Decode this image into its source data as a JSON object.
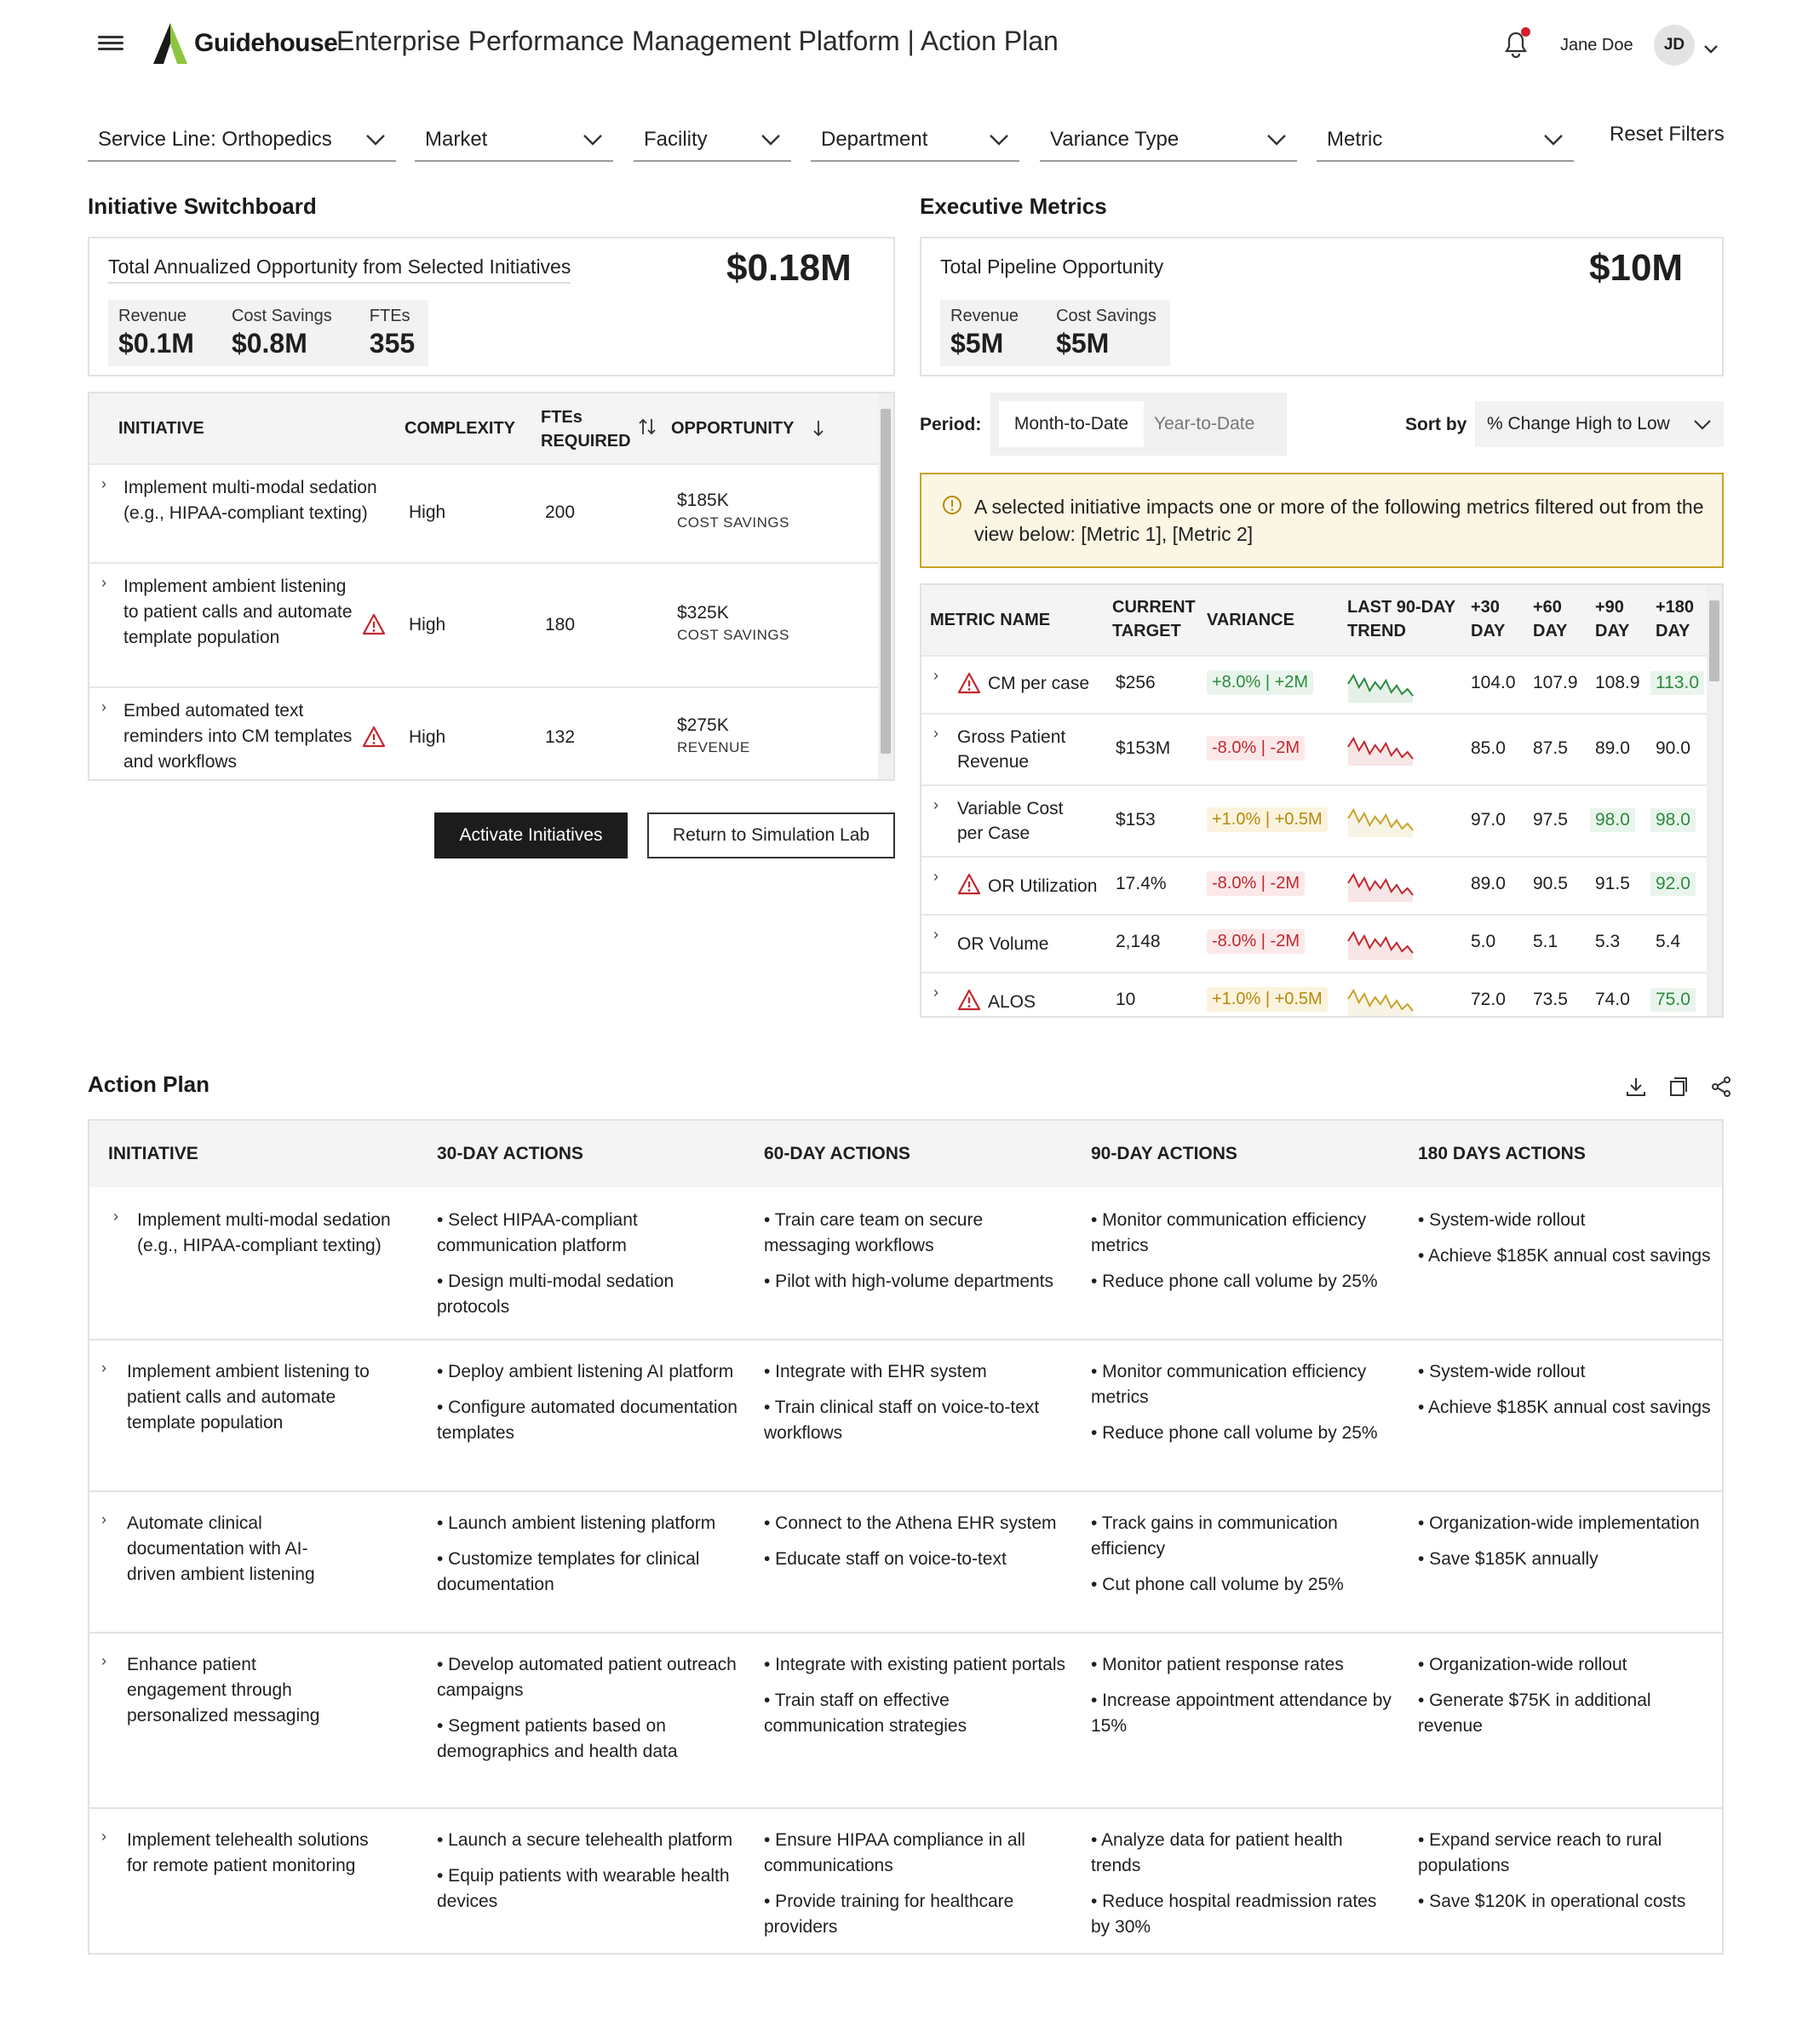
{
  "header": {
    "brand": "Guidehouse",
    "title": "Enterprise Performance Management Platform | Action Plan",
    "user_name": "Jane Doe",
    "user_initials": "JD"
  },
  "filters": [
    {
      "label": "Service Line: Orthopedics"
    },
    {
      "label": "Market"
    },
    {
      "label": "Facility"
    },
    {
      "label": "Department"
    },
    {
      "label": "Variance Type"
    },
    {
      "label": "Metric"
    }
  ],
  "reset_filters": "Reset Filters",
  "switchboard": {
    "title": "Initiative Switchboard",
    "summary_label": "Total Annualized Opportunity from Selected Initiatives",
    "summary_value": "$0.18M",
    "chips": [
      {
        "label": "Revenue",
        "value": "$0.1M"
      },
      {
        "label": "Cost Savings",
        "value": "$0.8M"
      },
      {
        "label": "FTEs",
        "value": "355"
      }
    ],
    "columns": {
      "initiative": "INITIATIVE",
      "complexity": "COMPLEXITY",
      "ftes": "FTEs REQUIRED",
      "opportunity": "OPPORTUNITY"
    },
    "rows": [
      {
        "name": "Implement multi-modal sedation (e.g., HIPAA-compliant texting)",
        "complexity": "High",
        "ftes": "200",
        "opp_value": "$185K",
        "opp_type": "COST SAVINGS",
        "warning": false
      },
      {
        "name": "Implement ambient listening to patient calls and automate template population",
        "complexity": "High",
        "ftes": "180",
        "opp_value": "$325K",
        "opp_type": "COST SAVINGS",
        "warning": true
      },
      {
        "name": "Embed automated text reminders into CM templates and workflows",
        "complexity": "High",
        "ftes": "132",
        "opp_value": "$275K",
        "opp_type": "REVENUE",
        "warning": true
      }
    ],
    "activate_label": "Activate Initiatives",
    "return_label": "Return to Simulation Lab"
  },
  "executive": {
    "title": "Executive Metrics",
    "summary_label": "Total Pipeline Opportunity",
    "summary_value": "$10M",
    "chips": [
      {
        "label": "Revenue",
        "value": "$5M"
      },
      {
        "label": "Cost Savings",
        "value": "$5M"
      }
    ],
    "period_label": "Period:",
    "period_options": [
      "Month-to-Date",
      "Year-to-Date"
    ],
    "sort_label": "Sort by",
    "sort_value": "% Change High to Low",
    "alert": "A selected initiative impacts one or more of the following metrics filtered out from the view below: [Metric 1], [Metric 2]",
    "columns": {
      "name": "METRIC NAME",
      "target": "CURRENT TARGET",
      "variance": "VARIANCE",
      "trend": "LAST 90-DAY TREND",
      "d30": "+30 DAY",
      "d60": "+60 DAY",
      "d90": "+90 DAY",
      "d180": "+180 DAY"
    },
    "rows": [
      {
        "name": "CM per case",
        "warning": true,
        "target": "$256",
        "variance": "+8.0% | +2M",
        "tone": "pos",
        "d30": "104.0",
        "d60": "107.9",
        "d90": "108.9",
        "d180": "113.0",
        "hl": [
          false,
          false,
          false,
          true
        ]
      },
      {
        "name": "Gross Patient Revenue",
        "warning": false,
        "target": "$153M",
        "variance": "-8.0% | -2M",
        "tone": "neg",
        "d30": "85.0",
        "d60": "87.5",
        "d90": "89.0",
        "d180": "90.0",
        "hl": [
          false,
          false,
          false,
          false
        ]
      },
      {
        "name": "Variable Cost per Case",
        "warning": false,
        "target": "$153",
        "variance": "+1.0% | +0.5M",
        "tone": "mix",
        "d30": "97.0",
        "d60": "97.5",
        "d90": "98.0",
        "d180": "98.0",
        "hl": [
          false,
          false,
          true,
          true
        ]
      },
      {
        "name": "OR Utilization",
        "warning": true,
        "target": "17.4%",
        "variance": "-8.0% | -2M",
        "tone": "neg",
        "d30": "89.0",
        "d60": "90.5",
        "d90": "91.5",
        "d180": "92.0",
        "hl": [
          false,
          false,
          false,
          true
        ]
      },
      {
        "name": "OR Volume",
        "warning": false,
        "target": "2,148",
        "variance": "-8.0% | -2M",
        "tone": "neg",
        "d30": "5.0",
        "d60": "5.1",
        "d90": "5.3",
        "d180": "5.4",
        "hl": [
          false,
          false,
          false,
          false
        ]
      },
      {
        "name": "ALOS",
        "warning": true,
        "target": "10",
        "variance": "+1.0% | +0.5M",
        "tone": "mix",
        "d30": "72.0",
        "d60": "73.5",
        "d90": "74.0",
        "d180": "75.0",
        "hl": [
          false,
          false,
          false,
          true
        ]
      }
    ],
    "colors": {
      "pos": "#2c8a3f",
      "neg": "#c2272d",
      "mix": "#c9a227"
    }
  },
  "action_plan": {
    "title": "Action Plan",
    "columns": [
      "INITIATIVE",
      "30-DAY ACTIONS",
      "60-DAY ACTIONS",
      "90-DAY ACTIONS",
      "180 DAYS ACTIONS"
    ],
    "rows": [
      {
        "name": "Implement multi-modal sedation (e.g., HIPAA-compliant texting)",
        "a30": [
          "• Select HIPAA-compliant communication platform",
          "• Design multi-modal sedation protocols"
        ],
        "a60": [
          "• Train care team on secure messaging workflows",
          "• Pilot with high-volume departments"
        ],
        "a90": [
          "• Monitor communication efficiency metrics",
          "• Reduce phone call volume by 25%"
        ],
        "a180": [
          "• System-wide rollout",
          "• Achieve $185K annual cost savings"
        ]
      },
      {
        "name": "Implement ambient listening to patient calls and automate template population",
        "a30": [
          "• Deploy ambient listening AI platform",
          "• Configure automated documentation templates"
        ],
        "a60": [
          "• Integrate with EHR system",
          "• Train clinical staff on voice-to-text workflows"
        ],
        "a90": [
          "• Monitor communication efficiency metrics",
          "• Reduce phone call volume by 25%"
        ],
        "a180": [
          "• System-wide rollout",
          "• Achieve $185K annual cost savings"
        ]
      },
      {
        "name": "Automate clinical documentation with AI-driven ambient listening",
        "a30": [
          "• Launch ambient listening platform",
          "• Customize templates for clinical documentation"
        ],
        "a60": [
          "• Connect to the Athena EHR system",
          "• Educate staff on voice-to-text"
        ],
        "a90": [
          "• Track gains in communication efficiency",
          "• Cut phone call volume by 25%"
        ],
        "a180": [
          "• Organization-wide implementation",
          "• Save $185K annually"
        ]
      },
      {
        "name": "Enhance patient engagement through personalized messaging",
        "a30": [
          "• Develop automated patient outreach campaigns",
          "• Segment patients based on demographics and health data"
        ],
        "a60": [
          "• Integrate with existing patient portals",
          "• Train staff on effective communication strategies"
        ],
        "a90": [
          "• Monitor patient response rates",
          "• Increase appointment attendance by 15%"
        ],
        "a180": [
          "• Organization-wide rollout",
          "• Generate $75K in additional revenue"
        ]
      },
      {
        "name": "Implement telehealth solutions for remote patient monitoring",
        "a30": [
          "• Launch a secure telehealth platform",
          "• Equip patients with wearable health devices"
        ],
        "a60": [
          "• Ensure HIPAA compliance in all communications",
          "• Provide training for healthcare providers"
        ],
        "a90": [
          "• Analyze data for patient health trends",
          "• Reduce hospital readmission rates by 30%"
        ],
        "a180": [
          "• Expand service reach to rural populations",
          "• Save $120K in operational costs"
        ]
      }
    ]
  }
}
